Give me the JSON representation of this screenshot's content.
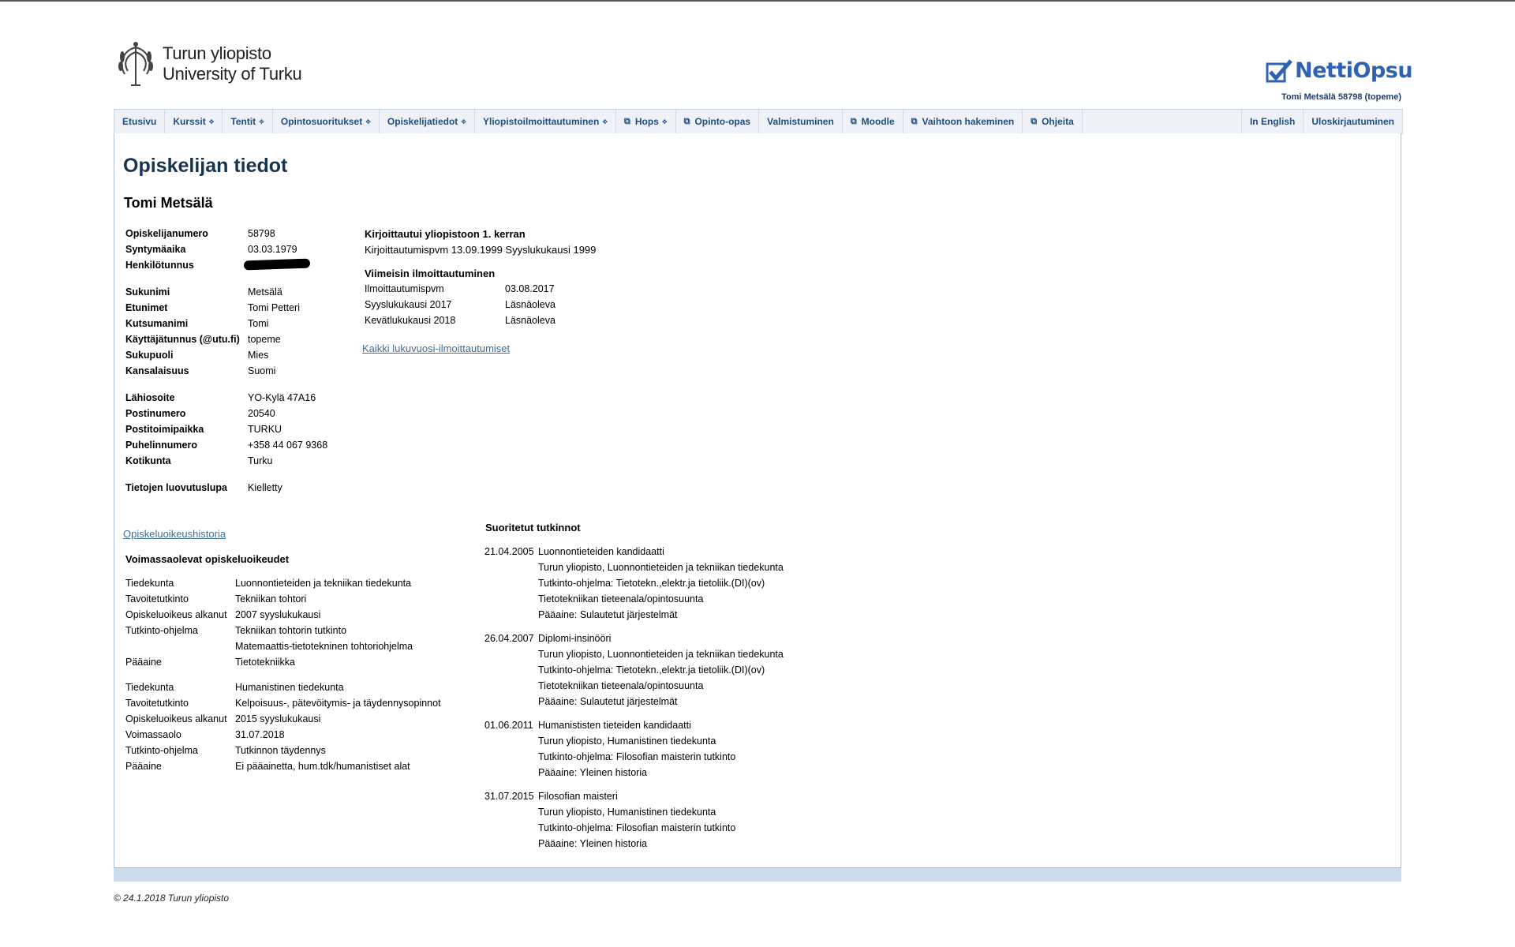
{
  "header": {
    "logo_line1": "Turun yliopisto",
    "logo_line2": "University of Turku",
    "brand": "NettiOpsu",
    "user_info": "Tomi Metsälä 58798 (topeme)"
  },
  "nav": {
    "etusivu": "Etusivu",
    "kurssit": "Kurssit",
    "tentit": "Tentit",
    "opintosuoritukset": "Opintosuoritukset",
    "opiskelijatiedot": "Opiskelijatiedot",
    "yliopistoilmoittautuminen": "Yliopistoilmoittautuminen",
    "hops": "Hops",
    "opinto_opas": "Opinto-opas",
    "valmistuminen": "Valmistuminen",
    "moodle": "Moodle",
    "vaihtoon": "Vaihtoon hakeminen",
    "ohjeita": "Ohjeita",
    "in_english": "In English",
    "uloskirjautuminen": "Uloskirjautuminen"
  },
  "page": {
    "title": "Opiskelijan tiedot",
    "student_name": "Tomi Metsälä"
  },
  "basic": [
    {
      "label": "Opiskelijanumero",
      "value": "58798"
    },
    {
      "label": "Syntymäaika",
      "value": "03.03.1979"
    },
    {
      "label": "Henkilötunnus",
      "value": ""
    },
    {
      "label": "Sukunimi",
      "value": "Metsälä"
    },
    {
      "label": "Etunimet",
      "value": "Tomi Petteri"
    },
    {
      "label": "Kutsumanimi",
      "value": "Tomi"
    },
    {
      "label": "Käyttäjätunnus (@utu.fi)",
      "value": "topeme"
    },
    {
      "label": "Sukupuoli",
      "value": "Mies"
    },
    {
      "label": "Kansalaisuus",
      "value": "Suomi"
    },
    {
      "label": "Lähiosoite",
      "value": "YO-Kylä 47A16"
    },
    {
      "label": "Postinumero",
      "value": "20540"
    },
    {
      "label": "Postitoimipaikka",
      "value": "TURKU"
    },
    {
      "label": "Puhelinnumero",
      "value": "+358 44 067 9368"
    },
    {
      "label": "Kotikunta",
      "value": "Turku"
    },
    {
      "label": "Tietojen luovutuslupa",
      "value": "Kielletty"
    }
  ],
  "enrollment": {
    "first_heading": "Kirjoittautui yliopistoon 1. kerran",
    "first_text": "Kirjoittautumispvm 13.09.1999 Syyslukukausi 1999",
    "latest_heading": "Viimeisin ilmoittautuminen",
    "latest": [
      {
        "label": "Ilmoittautumispvm",
        "value": "03.08.2017"
      },
      {
        "label": "Syyslukukausi 2017",
        "value": "Läsnäoleva"
      },
      {
        "label": "Kevätlukukausi 2018",
        "value": "Läsnäoleva"
      }
    ],
    "all_link": "Kaikki lukuvuosi-ilmoittautumiset"
  },
  "rights": {
    "history_link": "Opiskeluoikeushistoria",
    "heading": "Voimassaolevat opiskeluoikeudet",
    "block1": [
      {
        "label": "Tiedekunta",
        "value": "Luonnontieteiden ja tekniikan tiedekunta"
      },
      {
        "label": "Tavoitetutkinto",
        "value": "Tekniikan tohtori"
      },
      {
        "label": "Opiskeluoikeus alkanut",
        "value": "2007 syyslukukausi"
      },
      {
        "label": "Tutkinto-ohjelma",
        "value": "Tekniikan tohtorin tutkinto"
      },
      {
        "label": "",
        "value": "Matemaattis-tietotekninen tohtoriohjelma"
      },
      {
        "label": "Pääaine",
        "value": "Tietotekniikka"
      }
    ],
    "block2": [
      {
        "label": "Tiedekunta",
        "value": "Humanistinen tiedekunta"
      },
      {
        "label": "Tavoitetutkinto",
        "value": "Kelpoisuus-, pätevöitymis- ja täydennysopinnot"
      },
      {
        "label": "Opiskeluoikeus alkanut",
        "value": "2015 syyslukukausi"
      },
      {
        "label": "Voimassaolo",
        "value": "31.07.2018"
      },
      {
        "label": "Tutkinto-ohjelma",
        "value": "Tutkinnon täydennys"
      },
      {
        "label": "Pääaine",
        "value": "Ei pääainetta, hum.tdk/humanistiset alat"
      }
    ]
  },
  "degrees": {
    "heading": "Suoritetut tutkinnot",
    "items": [
      {
        "date": "21.04.2005",
        "title": "Luonnontieteiden kandidaatti",
        "lines": [
          "Turun yliopisto, Luonnontieteiden ja tekniikan tiedekunta",
          "Tutkinto-ohjelma: Tietotekn.,elektr.ja tietoliik.(DI)(ov)",
          "Tietotekniikan tieteenala/opintosuunta",
          "Pääaine: Sulautetut järjestelmät"
        ]
      },
      {
        "date": "26.04.2007",
        "title": "Diplomi-insinööri",
        "lines": [
          "Turun yliopisto, Luonnontieteiden ja tekniikan tiedekunta",
          "Tutkinto-ohjelma: Tietotekn.,elektr.ja tietoliik.(DI)(ov)",
          "Tietotekniikan tieteenala/opintosuunta",
          "Pääaine: Sulautetut järjestelmät"
        ]
      },
      {
        "date": "01.06.2011",
        "title": "Humanististen tieteiden kandidaatti",
        "lines": [
          "Turun yliopisto, Humanistinen tiedekunta",
          "Tutkinto-ohjelma: Filosofian maisterin tutkinto",
          "Pääaine: Yleinen historia"
        ]
      },
      {
        "date": "31.07.2015",
        "title": "Filosofian maisteri",
        "lines": [
          "Turun yliopisto, Humanistinen tiedekunta",
          "Tutkinto-ohjelma: Filosofian maisterin tutkinto",
          "Pääaine: Yleinen historia"
        ]
      }
    ]
  },
  "footer": {
    "copyright": "© 24.1.2018 Turun yliopisto"
  },
  "colors": {
    "nav_text": "#1f4f86",
    "title": "#16344f",
    "link": "#3c6e99",
    "brand": "#2f62b3",
    "footer_bar": "#cdd9ec"
  }
}
